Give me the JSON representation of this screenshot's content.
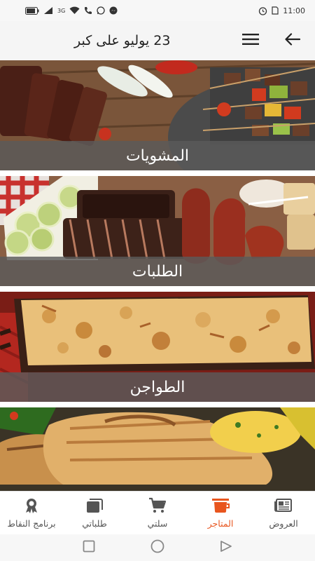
{
  "status_bar": {
    "time": "11:00",
    "network": "3G"
  },
  "header": {
    "title": "23 يوليو على كبر"
  },
  "categories": [
    {
      "label": "المشويات"
    },
    {
      "label": "الطلبات"
    },
    {
      "label": "الطواجن"
    },
    {
      "label": ""
    }
  ],
  "bottom_nav": {
    "items": [
      {
        "label": "العروض",
        "icon": "newspaper-icon"
      },
      {
        "label": "المتاجر",
        "icon": "store-cup-icon"
      },
      {
        "label": "سلتي",
        "icon": "cart-icon"
      },
      {
        "label": "طلباتي",
        "icon": "orders-stack-icon"
      },
      {
        "label": "برنامج النقاط",
        "icon": "award-badge-icon"
      }
    ],
    "active_index": 1
  },
  "colors": {
    "accent": "#e8551e",
    "caption_overlay": "#5a5a5a"
  }
}
